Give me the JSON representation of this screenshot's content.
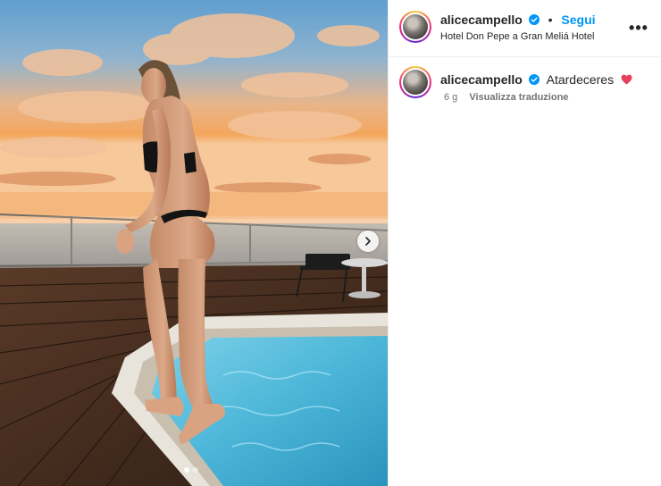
{
  "post": {
    "username": "alicecampello",
    "follow_label": "Segui",
    "separator": "•",
    "location": "Hotel Don Pepe a Gran Meliá Hotel",
    "more_icon": "more-options-icon",
    "more_label": "•••"
  },
  "caption": {
    "username": "alicecampello",
    "text": "Atardeceres",
    "emoji": "heart-icon",
    "time": "6 g",
    "translate_label": "Visualizza traduzione"
  },
  "carousel": {
    "slide_count": 2,
    "current_slide": 1
  },
  "colors": {
    "accent": "#0095f6",
    "verified": "#0095f6",
    "heart": "#e8415b"
  }
}
